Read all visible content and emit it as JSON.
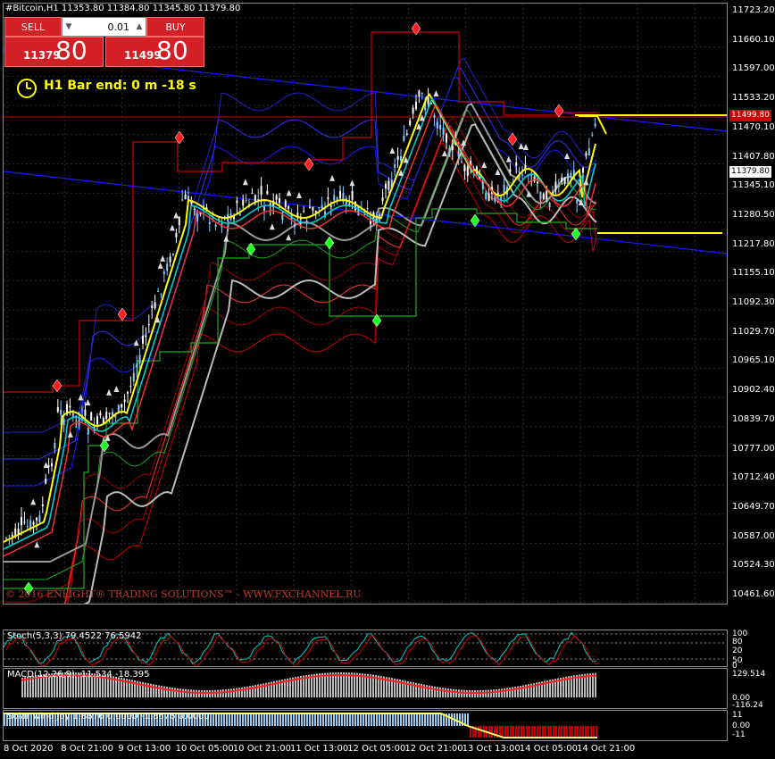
{
  "window": {
    "symbol_title": "#Bitcoin,H1  11353.80  11384.80  11345.80  11379.80"
  },
  "trade_panel": {
    "sell_label": "SELL",
    "buy_label": "BUY",
    "lot_value": "0.01",
    "sell_price_small": "11379",
    "sell_price_big": "80",
    "buy_price_small": "11499",
    "buy_price_big": "80"
  },
  "bar_end": {
    "text": "H1 Bar end: 0 m -18 s"
  },
  "copyright": "© 2016 ENLIGHT® TRADING SOLUTIONS™ - WWW.FXCHANNEL.RU",
  "price_axis": {
    "labels": [
      "11723.20",
      "11660.10",
      "11597.00",
      "11533.20",
      "11470.10",
      "11407.80",
      "11345.10",
      "11280.50",
      "11217.80",
      "11155.10",
      "11092.30",
      "11029.70",
      "10965.10",
      "10902.40",
      "10839.70",
      "10777.00",
      "10712.40",
      "10649.70",
      "10587.00",
      "10524.30",
      "10461.60"
    ],
    "ask_tag": "11499.80",
    "bid_tag": "11379.80"
  },
  "stoch": {
    "title": "Stoch(5,3,3) 79.4522 76.5942",
    "levels": [
      "100",
      "80",
      "50",
      "20",
      "0"
    ]
  },
  "macd": {
    "title": "MACD(12,26,9) -11.534 -18.395",
    "levels": [
      "129.514",
      "0.00",
      "-116.24"
    ]
  },
  "solar": {
    "title": "Solar wind joy 1.8676 0.0000 -1.8676 0.0000",
    "levels": [
      "11",
      "0.00",
      "-11"
    ]
  },
  "date_axis": {
    "labels": [
      "8 Oct 2020",
      "8 Oct 21:00",
      "9 Oct 13:00",
      "10 Oct 05:00",
      "10 Oct 21:00",
      "11 Oct 13:00",
      "12 Oct 05:00",
      "12 Oct 21:00",
      "13 Oct 13:00",
      "14 Oct 05:00",
      "14 Oct 21:00"
    ]
  },
  "colors": {
    "background": "#000000",
    "sell_buy": "#d31f26",
    "close_line": "#ffff00",
    "red_level": "#cc0000",
    "blue_line": "#1a1aff"
  }
}
